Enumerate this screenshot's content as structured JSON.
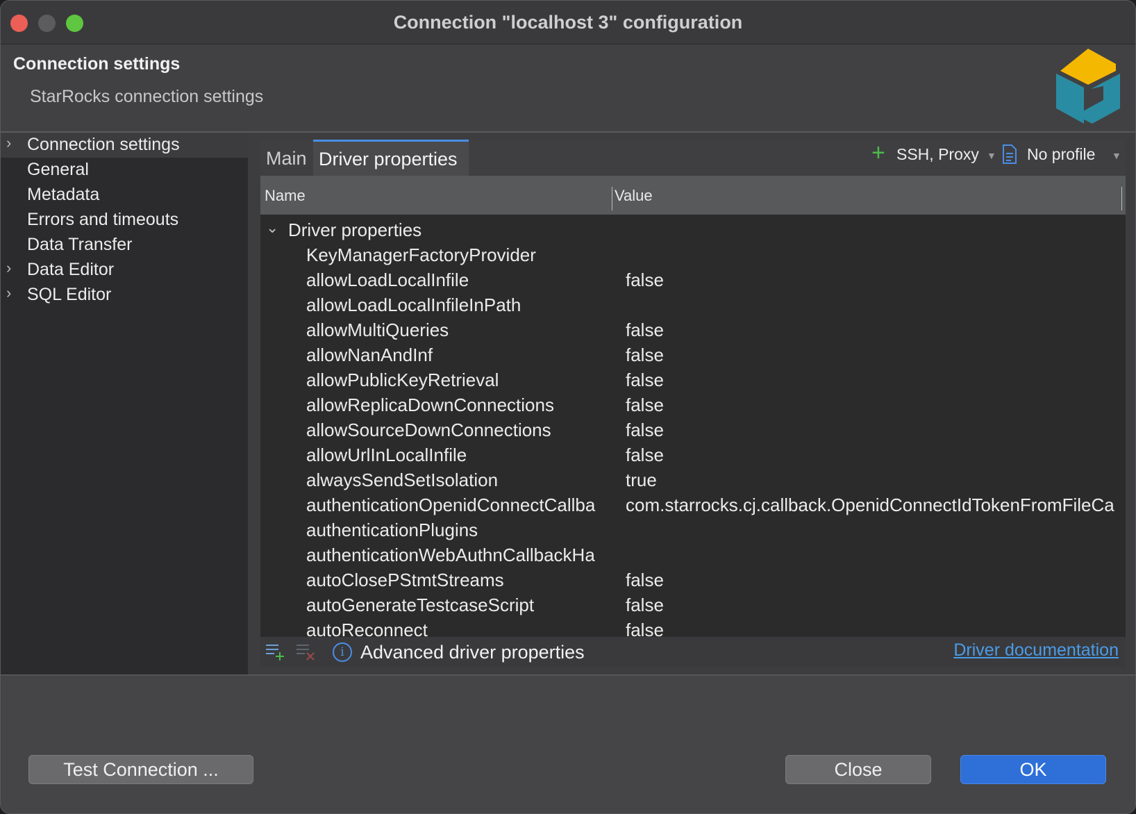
{
  "window": {
    "title": "Connection \"localhost 3\" configuration"
  },
  "header": {
    "title": "Connection settings",
    "subtitle": "StarRocks connection settings"
  },
  "sidebar": {
    "items": [
      {
        "label": "Connection settings",
        "expandable": true,
        "selected": true
      },
      {
        "label": "General",
        "expandable": false,
        "selected": false
      },
      {
        "label": "Metadata",
        "expandable": false,
        "selected": false
      },
      {
        "label": "Errors and timeouts",
        "expandable": false,
        "selected": false
      },
      {
        "label": "Data Transfer",
        "expandable": false,
        "selected": false
      },
      {
        "label": "Data Editor",
        "expandable": true,
        "selected": false
      },
      {
        "label": "SQL Editor",
        "expandable": true,
        "selected": false
      }
    ]
  },
  "tabs": [
    {
      "label": "Main",
      "active": false
    },
    {
      "label": "Driver properties",
      "active": true
    }
  ],
  "toolbar": {
    "ssh_label": "SSH, Proxy",
    "profile_label": "No profile"
  },
  "table": {
    "columns": [
      "Name",
      "Value"
    ],
    "group": "Driver properties",
    "rows": [
      {
        "name": "KeyManagerFactoryProvider",
        "value": ""
      },
      {
        "name": "allowLoadLocalInfile",
        "value": "false"
      },
      {
        "name": "allowLoadLocalInfileInPath",
        "value": ""
      },
      {
        "name": "allowMultiQueries",
        "value": "false"
      },
      {
        "name": "allowNanAndInf",
        "value": "false"
      },
      {
        "name": "allowPublicKeyRetrieval",
        "value": "false"
      },
      {
        "name": "allowReplicaDownConnections",
        "value": "false"
      },
      {
        "name": "allowSourceDownConnections",
        "value": "false"
      },
      {
        "name": "allowUrlInLocalInfile",
        "value": "false"
      },
      {
        "name": "alwaysSendSetIsolation",
        "value": "true"
      },
      {
        "name": "authenticationOpenidConnectCallba",
        "value": "com.starrocks.cj.callback.OpenidConnectIdTokenFromFileCa"
      },
      {
        "name": "authenticationPlugins",
        "value": ""
      },
      {
        "name": "authenticationWebAuthnCallbackHa",
        "value": ""
      },
      {
        "name": "autoClosePStmtStreams",
        "value": "false"
      },
      {
        "name": "autoGenerateTestcaseScript",
        "value": "false"
      },
      {
        "name": "autoReconnect",
        "value": "false"
      }
    ]
  },
  "table_footer": {
    "advanced_label": "Advanced driver properties",
    "doc_link": "Driver documentation"
  },
  "buttons": {
    "test": "Test Connection ...",
    "close": "Close",
    "ok": "OK"
  },
  "colors": {
    "accent": "#2e6fd8",
    "link": "#4a9ce8",
    "tab_indicator": "#4a8ee6",
    "add_icon": "#4cbb4c"
  }
}
